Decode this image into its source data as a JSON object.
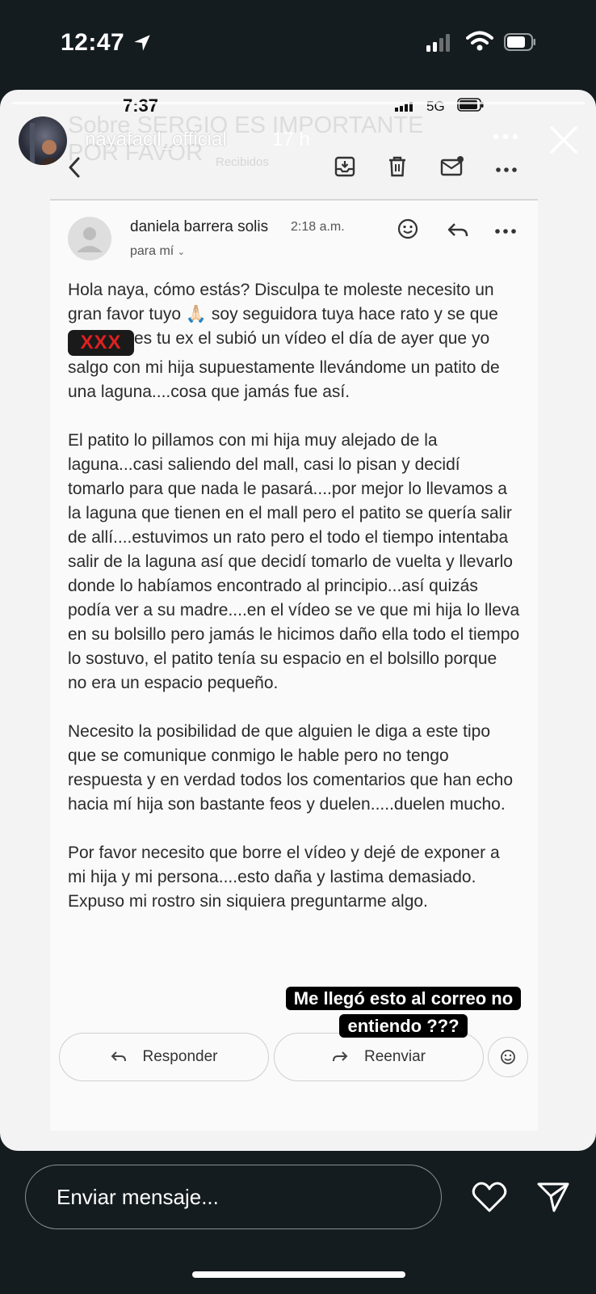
{
  "os_status": {
    "time": "12:47"
  },
  "story": {
    "username": "nayafacil_official",
    "age": "17 h",
    "caption": "Me llegó esto al correo no entiendo ???"
  },
  "screenshot_status": {
    "time": "7:37",
    "network": "5G"
  },
  "email_header": {
    "subject_ghost": "Sobre SERGIO ES IMPORTANTE POR FAVOR",
    "folder_ghost": "Recibidos"
  },
  "email": {
    "sender": "daniela barrera solis",
    "time": "2:18 a.m.",
    "to": "para mí",
    "censor_text": "XXX",
    "p1_before": "Hola naya, cómo estás? Disculpa te moleste necesito un gran favor tuyo 🙏🏻 soy seguidora tuya hace rato y se que ",
    "p1_after": "es tu ex el subió un vídeo el día de ayer que yo salgo con mi hija supuestamente llevándome un patito de una laguna....cosa que jamás fue así.",
    "p2": "El patito lo pillamos con mi hija muy alejado de la laguna...casi saliendo del mall, casi lo pisan y decidí tomarlo para que nada le pasará....por mejor lo llevamos a la laguna que tienen en el mall pero el patito se quería salir de allí....estuvimos un rato pero el todo el tiempo intentaba salir de la laguna así que decidí tomarlo de vuelta y llevarlo donde lo habíamos encontrado al principio...así quizás podía ver a su madre....en el vídeo se ve que mi hija lo lleva en su bolsillo pero jamás le hicimos daño ella todo el tiempo lo sostuvo, el patito tenía su espacio en el bolsillo porque no era un espacio pequeño.",
    "p3": "Necesito la posibilidad de que alguien le diga a este tipo que se comunique conmigo le hable pero no tengo respuesta y en verdad todos los comentarios que han echo hacia mí hija son bastante feos y duelen.....duelen mucho.",
    "p4": "Por favor necesito que borre el vídeo y dejé de exponer a mi hija y mi persona....esto daña y lastima demasiado. Expuso mi rostro sin siquiera preguntarme algo."
  },
  "actions": {
    "reply": "Responder",
    "forward": "Reenviar"
  },
  "bottom_bar": {
    "placeholder": "Enviar mensaje..."
  },
  "icons": [
    "location-arrow-icon",
    "signal-icon",
    "wifi-icon",
    "battery-icon",
    "more-icon",
    "close-icon",
    "back-chevron-icon",
    "archive-icon",
    "trash-icon",
    "mail-icon",
    "emoji-icon",
    "reply-icon",
    "forward-icon",
    "heart-icon",
    "send-icon"
  ]
}
